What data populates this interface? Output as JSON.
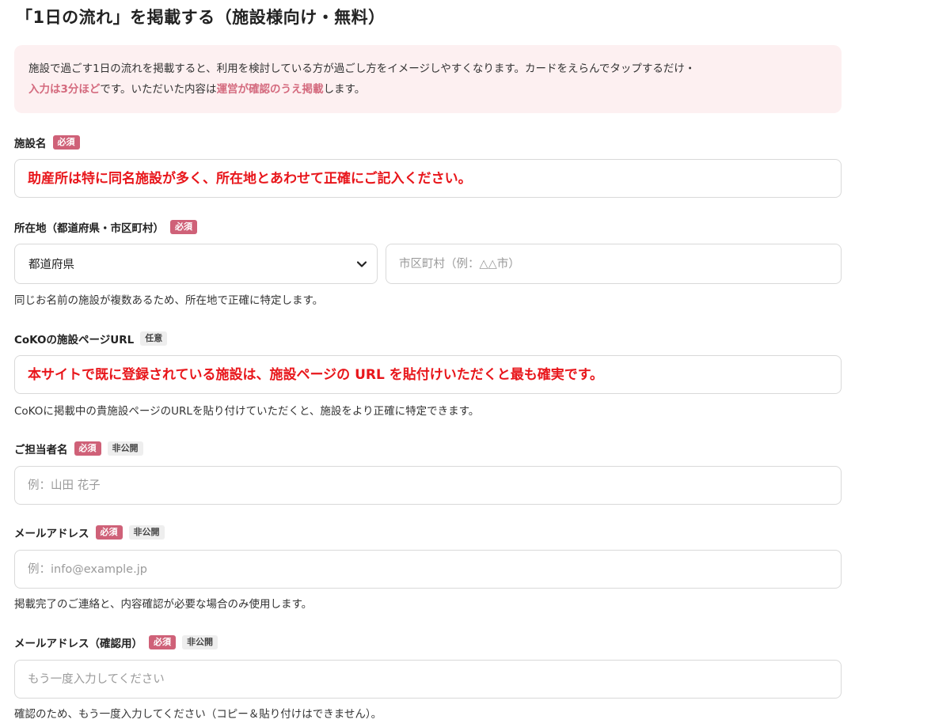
{
  "page": {
    "title": "「1日の流れ」を掲載する（施設様向け・無料）"
  },
  "intro": {
    "line1": "施設で過ごす1日の流れを掲載すると、利用を検討している方が過ごし方をイメージしやすくなります。カードをえらんでタップするだけ・",
    "highlight1": "入力は3分ほど",
    "mid": "です。いただいた内容は",
    "highlight2": "運営が確認のうえ掲載",
    "end": "します。"
  },
  "badges": {
    "required": "必須",
    "optional": "任意",
    "private": "非公開"
  },
  "facility_name": {
    "label": "施設名",
    "placeholder": "助産所は特に同名施設が多く、所在地とあわせて正確にご記入ください。"
  },
  "location": {
    "label": "所在地（都道府県・市区町村）",
    "prefecture_selected": "都道府県",
    "city_placeholder": "市区町村（例：△△市）",
    "help": "同じお名前の施設が複数あるため、所在地で正確に特定します。"
  },
  "coko_url": {
    "label": "CoKOの施設ページURL",
    "placeholder": "本サイトで既に登録されている施設は、施設ページの URL を貼付けいただくと最も確実です。",
    "help": "CoKOに掲載中の貴施設ページのURLを貼り付けていただくと、施設をより正確に特定できます。"
  },
  "contact_name": {
    "label": "ご担当者名",
    "placeholder": "例：山田 花子"
  },
  "email": {
    "label": "メールアドレス",
    "placeholder": "例：info@example.jp",
    "help": "掲載完了のご連絡と、内容確認が必要な場合のみ使用します。"
  },
  "email_confirm": {
    "label": "メールアドレス（確認用）",
    "placeholder": "もう一度入力してください",
    "help": "確認のため、もう一度入力してください（コピー＆貼り付けはできません）。"
  },
  "colors": {
    "accent": "#cf6178",
    "intro_bg": "#fdf0f1",
    "highlight_text": "#d46a7e",
    "emphasis_red": "#e8161b",
    "border": "#d9d9d9"
  },
  "icons": {
    "select_arrow": "chevron-down-icon"
  }
}
